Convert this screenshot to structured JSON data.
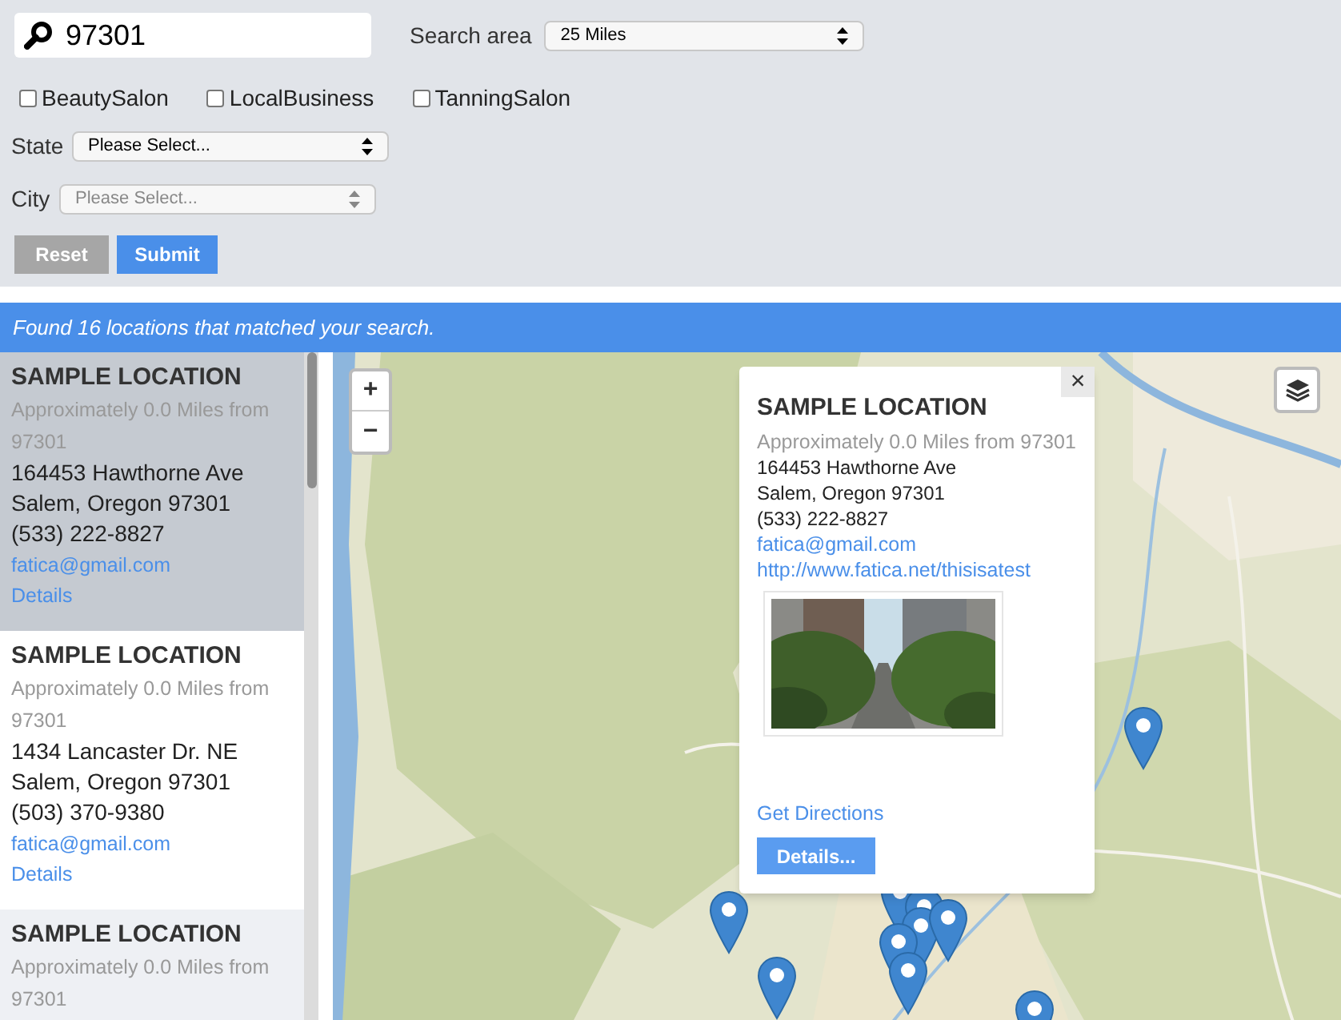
{
  "search": {
    "value": "97301"
  },
  "search_area": {
    "label": "Search area",
    "value": "25 Miles"
  },
  "categories": [
    {
      "label": "BeautySalon",
      "checked": false
    },
    {
      "label": "LocalBusiness",
      "checked": false
    },
    {
      "label": "TanningSalon",
      "checked": false
    }
  ],
  "state": {
    "label": "State",
    "value": "Please Select...",
    "disabled": false
  },
  "city": {
    "label": "City",
    "placeholder": "Please Select...",
    "disabled": true
  },
  "buttons": [
    {
      "kind": "reset",
      "label": "Reset"
    },
    {
      "kind": "submit",
      "label": "Submit"
    }
  ],
  "results_message": "Found 16 locations that matched your search.",
  "locations": [
    {
      "title": "SAMPLE LOCATION",
      "distance": "Approximately 0.0 Miles from 97301",
      "address": "164453 Hawthorne Ave",
      "city_line": "Salem, Oregon 97301",
      "phone": "(533) 222-8827",
      "email": "fatica@gmail.com",
      "details": "Details",
      "selected": true,
      "hovered": false
    },
    {
      "title": "SAMPLE LOCATION",
      "distance": "Approximately 0.0 Miles from 97301",
      "address": "1434 Lancaster Dr. NE",
      "city_line": "Salem, Oregon 97301",
      "phone": "(503) 370-9380",
      "email": "fatica@gmail.com",
      "details": "Details",
      "selected": false,
      "hovered": false
    },
    {
      "title": "SAMPLE LOCATION",
      "distance": "Approximately 0.0 Miles from 97301",
      "selected": false,
      "hovered": true
    }
  ],
  "map": {
    "zoom_in": "+",
    "zoom_out": "−",
    "popup": {
      "close": "×",
      "title": "SAMPLE LOCATION",
      "distance": "Approximately 0.0 Miles from 97301",
      "address": "164453 Hawthorne Ave",
      "city_line": "Salem, Oregon 97301",
      "phone": "(533) 222-8827",
      "email": "fatica@gmail.com",
      "website": "http://www.fatica.net/thisisatest",
      "directions": "Get Directions",
      "details": "Details..."
    }
  }
}
